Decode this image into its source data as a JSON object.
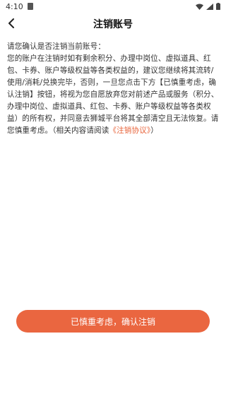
{
  "status_bar": {
    "time": "4:10"
  },
  "header": {
    "title": "注销账号"
  },
  "content": {
    "intro": "请您确认是否注销当前账号：",
    "body_1": "您的账户在注销时如有剩余积分、办理中岗位、虚拟道具、红包、卡券、账户等级权益等各类权益的，建议您继续将其流转/使用/消耗/兑换完毕，否则，一旦您点击下方【已慎重考虑，确认注销】按钮，将视为您自愿放弃您对前述产品或服务（积分、办理中岗位、虚拟道具、红包、卡券、账户等级权益等各类权益）的所有权，并同意去狮城平台将其全部清空且无法恢复。请您慎重考虑。（相关内容请阅读",
    "link_text": "《注销协议》",
    "body_2": "）"
  },
  "actions": {
    "confirm_label": "已慎重考虑，确认注销"
  },
  "colors": {
    "accent": "#ea6640",
    "link": "#e8633a"
  }
}
